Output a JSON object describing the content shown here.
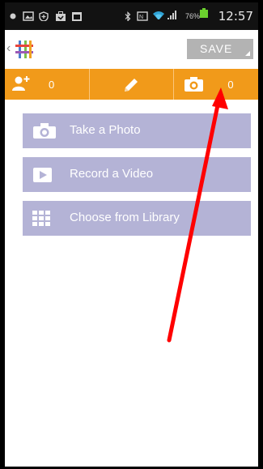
{
  "status_bar": {
    "time": "12:57",
    "battery_percent": "76%",
    "icons": [
      "notification-dot-icon",
      "image-icon",
      "shield-icon",
      "briefcase-icon",
      "calendar-icon",
      "bluetooth-icon",
      "nfc-icon",
      "wifi-icon",
      "signal-icon",
      "battery-icon"
    ]
  },
  "app_bar": {
    "save_label": "SAVE",
    "logo": "grid-logo"
  },
  "tabs": [
    {
      "icon": "add-person-icon",
      "count": "0"
    },
    {
      "icon": "pencil-icon",
      "count": ""
    },
    {
      "icon": "camera-icon",
      "count": "0"
    }
  ],
  "actions": [
    {
      "label": "Take a Photo",
      "icon": "camera-icon"
    },
    {
      "label": "Record a Video",
      "icon": "video-play-icon"
    },
    {
      "label": "Choose from Library",
      "icon": "grid-icon"
    }
  ],
  "colors": {
    "tab_bar": "#f19a1a",
    "action_button": "#b4b3d6",
    "save_button": "#b3b3b3",
    "annotation_arrow": "#ff0000"
  }
}
